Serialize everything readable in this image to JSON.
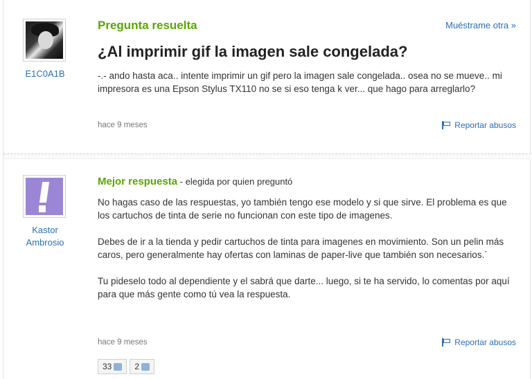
{
  "question": {
    "heading": "Pregunta resuelta",
    "more_link": "Muéstrame otra »",
    "title": "¿Al imprimir gif la imagen sale congelada?",
    "body": "-.- ando hasta aca.. intente imprimir un gif pero la imagen sale congelada.. osea no se mueve.. mi impresora es una Epson Stylus TX110 no se si eso tenga k ver... que hago para arreglarlo?",
    "time": "hace 9 meses",
    "report": "Reportar abusos",
    "user": "E1C0A1B"
  },
  "answer": {
    "heading": "Mejor respuesta",
    "chosen_by": " - elegida por quien preguntó",
    "paragraphs": [
      "No hagas caso de las respuestas, yo también tengo ese modelo y si que sirve. El problema es que los cartuchos de tinta de serie no funcionan con este tipo de imagenes.",
      "Debes de ir a la tienda y pedir cartuchos de tinta para imagenes en movimiento. Son un pelin más caros, pero generalmente hay ofertas con laminas de paper-live que también son necesarios.´",
      "Tu pideselo todo al dependiente y el sabrá que darte... luego, si te ha servido, lo comentas por aquí para que más gente como tú vea la respuesta."
    ],
    "time": "hace 9 meses",
    "report": "Reportar abusos",
    "user_line1": "Kastor",
    "user_line2": "Ambrosio",
    "thumbs_up": "33",
    "thumbs_down": "2"
  }
}
